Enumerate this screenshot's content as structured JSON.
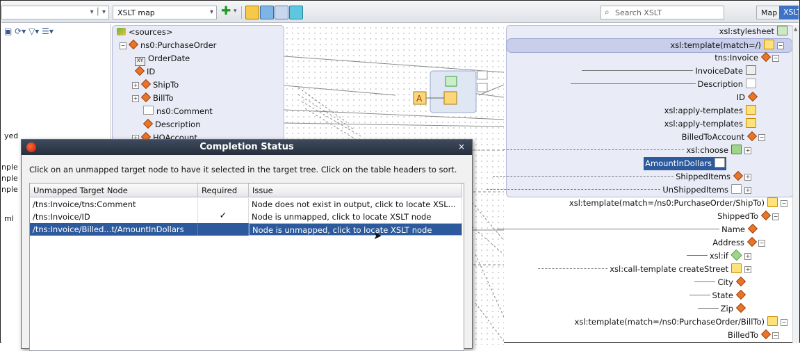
{
  "toolbar": {
    "left_combo_value": "",
    "map_combo_value": "XSLT map",
    "search_placeholder": "Search XSLT",
    "map_tab": "Map",
    "xslt_tab": "XSLT"
  },
  "left_panel": {
    "labels": [
      "yed",
      "nple",
      "nple",
      "nple",
      "ml"
    ]
  },
  "source_tree": {
    "root": "<sources>",
    "items": [
      {
        "label": "ns0:PurchaseOrder",
        "icon": "element-icon",
        "expander": "−"
      },
      {
        "label": "OrderDate",
        "icon": "xml-type-icon",
        "expander": ""
      },
      {
        "label": "ID",
        "icon": "element-icon",
        "expander": ""
      },
      {
        "label": "ShipTo",
        "icon": "element-icon",
        "expander": "+"
      },
      {
        "label": "BillTo",
        "icon": "element-icon",
        "expander": "+"
      },
      {
        "label": "ns0:Comment",
        "icon": "comment-icon",
        "expander": ""
      },
      {
        "label": "Description",
        "icon": "element-icon",
        "expander": ""
      },
      {
        "label": "HOAccount",
        "icon": "element-icon",
        "expander": "+"
      }
    ]
  },
  "target_tree": {
    "items": [
      {
        "label": "xsl:stylesheet",
        "icon": "stylesheet-icon"
      },
      {
        "label": "xsl:template(match=/)",
        "icon": "template-icon"
      },
      {
        "label": "tns:Invoice",
        "icon": "element-icon"
      },
      {
        "label": "InvoiceDate",
        "icon": "xml-type-icon"
      },
      {
        "label": "Description",
        "icon": "comment-icon"
      },
      {
        "label": "ID",
        "icon": "element-icon"
      },
      {
        "label": "xsl:apply-templates",
        "icon": "apply-templates-icon"
      },
      {
        "label": "xsl:apply-templates",
        "icon": "apply-templates-icon"
      },
      {
        "label": "BilledToAccount",
        "icon": "element-icon"
      },
      {
        "label": "xsl:choose",
        "icon": "choose-icon"
      },
      {
        "label": "AmountInDollars",
        "icon": "comment-icon"
      },
      {
        "label": "ShippedItems",
        "icon": "element-icon"
      },
      {
        "label": "UnShippedItems",
        "icon": "comment-icon"
      },
      {
        "label": "xsl:template(match=/ns0:PurchaseOrder/ShipTo)",
        "icon": "template-icon"
      },
      {
        "label": "ShippedTo",
        "icon": "element-icon"
      },
      {
        "label": "Name",
        "icon": "element-icon"
      },
      {
        "label": "Address",
        "icon": "element-icon"
      },
      {
        "label": "xsl:if",
        "icon": "if-icon"
      },
      {
        "label": "xsl:call-template createStreet",
        "icon": "call-template-icon"
      },
      {
        "label": "City",
        "icon": "element-icon"
      },
      {
        "label": "State",
        "icon": "element-icon"
      },
      {
        "label": "Zip",
        "icon": "element-icon"
      },
      {
        "label": "xsl:template(match=/ns0:PurchaseOrder/BillTo)",
        "icon": "template-icon"
      },
      {
        "label": "BilledTo",
        "icon": "element-icon"
      }
    ]
  },
  "dialog": {
    "title": "Completion Status",
    "close": "×",
    "instruction": "Click on an unmapped target node to have it selected in the target tree. Click on the table headers to sort.",
    "columns": [
      "Unmapped Target Node",
      "Required",
      "Issue"
    ],
    "rows": [
      {
        "node": "/tns:Invoice/tns:Comment",
        "required": "",
        "issue": "Node does not exist in output, click to locate XSL..."
      },
      {
        "node": "/tns:Invoice/ID",
        "required": "✓",
        "issue": "Node is unmapped, click to locate XSLT node"
      },
      {
        "node": "/tns:Invoice/Billed...t/AmountInDollars",
        "required": "",
        "issue": "Node is unmapped, click to locate XSLT node"
      }
    ]
  },
  "colors": {
    "accent_blue": "#2d5a9c",
    "panel_lavender": "#e9ebf6",
    "element_orange": "#e8762a",
    "dialog_title_dark": "#2b3442"
  }
}
